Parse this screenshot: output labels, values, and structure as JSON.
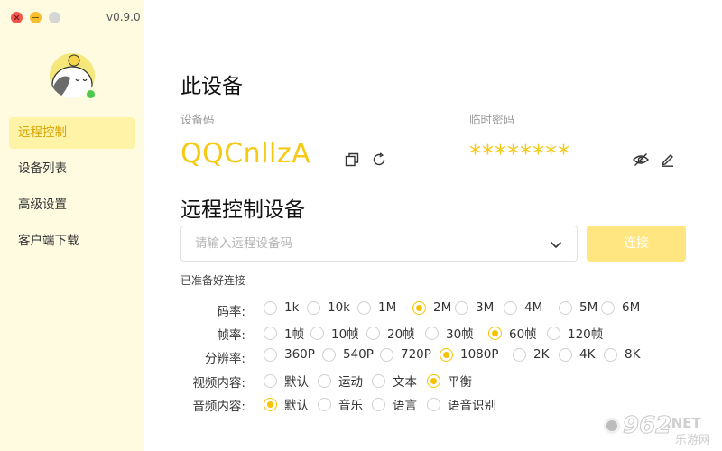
{
  "app": {
    "version": "v0.9.0"
  },
  "nav": [
    {
      "label": "远程控制",
      "active": true
    },
    {
      "label": "设备列表",
      "active": false
    },
    {
      "label": "高级设置",
      "active": false
    },
    {
      "label": "客户端下载",
      "active": false
    }
  ],
  "device": {
    "title": "此设备",
    "code_label": "设备码",
    "code": "QQCnllzA",
    "pwd_label": "临时密码",
    "pwd": "********"
  },
  "remote": {
    "title": "远程控制设备",
    "placeholder": "请输入远程设备码",
    "value": "",
    "connect_label": "连接",
    "status": "已准备好连接"
  },
  "options": {
    "bitrate": {
      "label": "码率:",
      "items": [
        "1k",
        "10k",
        "1M",
        "2M",
        "3M",
        "4M",
        "5M",
        "6M"
      ],
      "selected": "2M"
    },
    "framerate": {
      "label": "帧率:",
      "items": [
        "1帧",
        "10帧",
        "20帧",
        "30帧",
        "60帧",
        "120帧"
      ],
      "selected": "60帧"
    },
    "resolution": {
      "label": "分辨率:",
      "items": [
        "360P",
        "540P",
        "720P",
        "1080P",
        "2K",
        "4K",
        "8K"
      ],
      "selected": "1080P"
    },
    "video": {
      "label": "视频内容:",
      "items": [
        "默认",
        "运动",
        "文本",
        "平衡"
      ],
      "selected": "平衡"
    },
    "audio": {
      "label": "音频内容:",
      "items": [
        "默认",
        "音乐",
        "语言",
        "语音识别"
      ],
      "selected": "默认"
    }
  },
  "watermark": {
    "brand": "962",
    "suffix": ".NET",
    "sub": "乐游网"
  },
  "colors": {
    "accent": "#f6c914",
    "sidebar_bg": "#fffbe0",
    "active_bg": "#fff3a8"
  }
}
